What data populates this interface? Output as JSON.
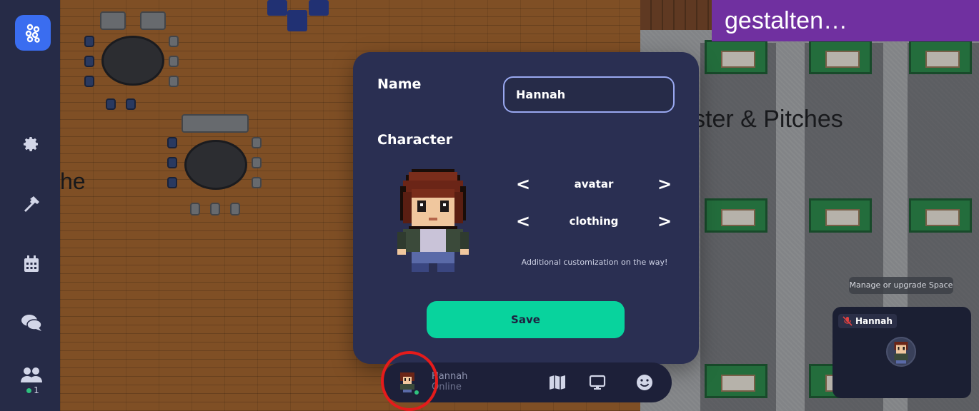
{
  "banner": {
    "text": "gestalten…"
  },
  "map": {
    "left_label": "he",
    "right_label": "ster & Pitches"
  },
  "sidebar": {
    "items": [
      {
        "icon": "gear-icon"
      },
      {
        "icon": "hammer-icon"
      },
      {
        "icon": "calendar-icon"
      },
      {
        "icon": "chat-icon"
      },
      {
        "icon": "people-icon"
      }
    ],
    "online_count": "1"
  },
  "modal": {
    "name_label": "Name",
    "name_value": "Hannah",
    "character_label": "Character",
    "avatar_option": "avatar",
    "clothing_option": "clothing",
    "prev_glyph": "<",
    "next_glyph": ">",
    "note": "Additional customization on the way!",
    "save_label": "Save"
  },
  "bottom_bar": {
    "name": "Hannah",
    "status": "Online",
    "icons": [
      "map-icon",
      "screen-share-icon",
      "emoji-icon"
    ]
  },
  "tooltip": {
    "text": "Manage or upgrade Space"
  },
  "video": {
    "name": "Hannah",
    "mic": "muted"
  },
  "colors": {
    "sidebar_bg": "#262b47",
    "modal_bg": "#2a2f52",
    "save_green": "#08d39d",
    "banner_purple": "#7030a0",
    "highlight_red": "#e51b1b"
  }
}
